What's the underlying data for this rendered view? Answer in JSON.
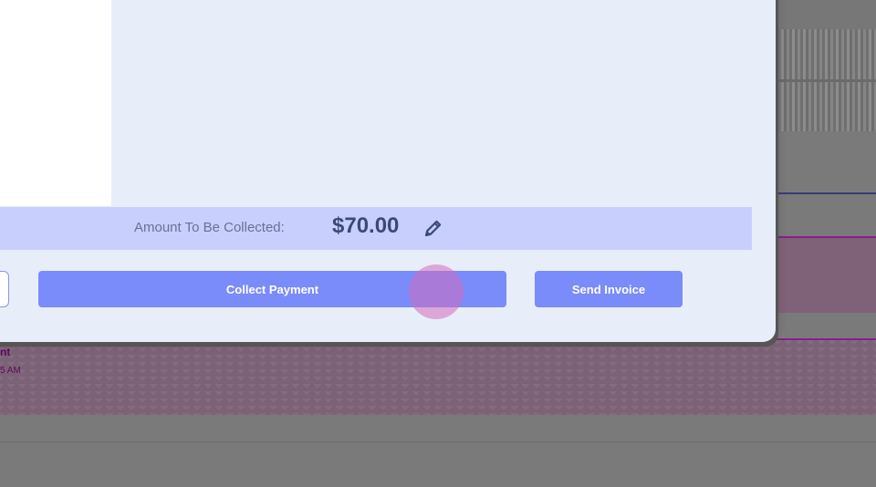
{
  "background": {
    "event": {
      "title": "nt",
      "time": "5 AM"
    }
  },
  "modal": {
    "amount": {
      "label": "Amount To Be Collected:",
      "value": "$70.00",
      "edit_icon": "pencil-icon"
    },
    "buttons": {
      "collect_payment": "Collect Payment",
      "send_invoice": "Send Invoice"
    }
  },
  "colors": {
    "modal_bg": "#e8eef9",
    "amount_bar": "#c9cffd",
    "primary_button": "#7a8bfa",
    "amount_text": "#3b4a75",
    "event_border": "#8a1d8a"
  }
}
